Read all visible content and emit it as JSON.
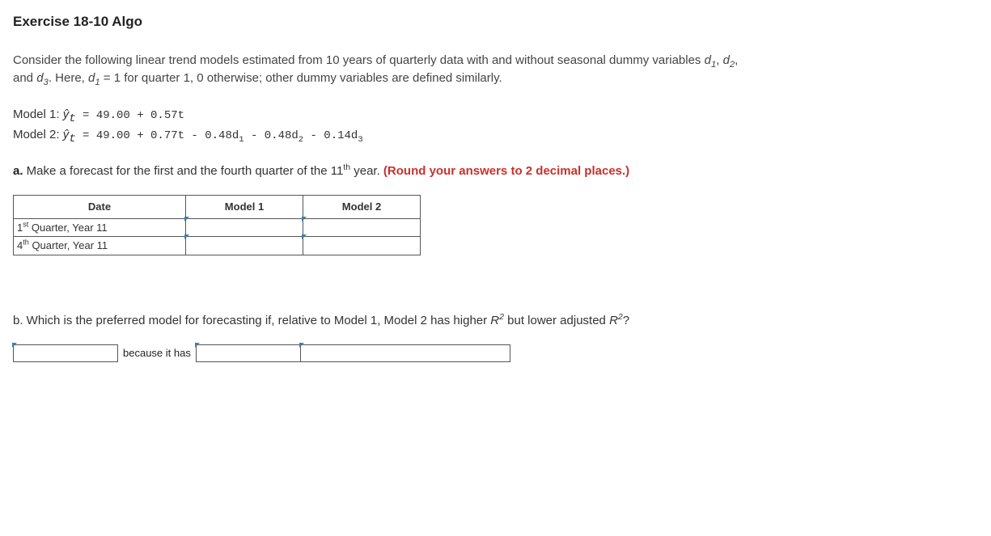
{
  "title": "Exercise 18-10 Algo",
  "intro": {
    "part1": "Consider the following linear trend models estimated from 10 years of quarterly data with and without seasonal dummy variables ",
    "d1": "d",
    "d1_sub": "1",
    "comma1": ", ",
    "d2": "d",
    "d2_sub": "2",
    "comma2": ",",
    "line2a": "and ",
    "d3": "d",
    "d3_sub": "3",
    "line2b": ".  Here, ",
    "d1b": "d",
    "d1b_sub": "1",
    "line2c": " = 1 for quarter 1, 0 otherwise; other dummy variables are defined similarly."
  },
  "models": {
    "m1_label": "Model 1: ",
    "m1_yhat": "ŷ",
    "m1_t": "t",
    "m1_eq": " = 49.00 + 0.57t",
    "m2_label": "Model 2: ",
    "m2_yhat": "ŷ",
    "m2_t": "t",
    "m2_eq_a": " = 49.00 + 0.77t - 0.48d",
    "m2_eq_1": "1",
    "m2_eq_b": " - 0.48d",
    "m2_eq_2": "2",
    "m2_eq_c": " - 0.14d",
    "m2_eq_3": "3"
  },
  "partA": {
    "label": "a.",
    "text1": " Make a forecast for the first and the fourth quarter of the 11",
    "th": "th",
    "text2": " year. ",
    "red": "(Round your answers to 2 decimal places.)"
  },
  "table": {
    "headers": {
      "c0": "Date",
      "c1": "Model 1",
      "c2": "Model 2"
    },
    "rows": [
      {
        "sup": "st",
        "pre": "1",
        "post": " Quarter, Year 11",
        "m1": "",
        "m2": ""
      },
      {
        "sup": "th",
        "pre": "4",
        "post": " Quarter, Year 11",
        "m1": "",
        "m2": ""
      }
    ]
  },
  "partB": {
    "label": "b.",
    "text1": " Which is the preferred model for forecasting if, relative to Model 1, Model 2 has higher ",
    "r2_a": "R",
    "sq": "2",
    "text2": " but lower adjusted ",
    "r2_b": "R",
    "text3": "?"
  },
  "blanks": {
    "b1": "",
    "middle": "because it has",
    "b2": "",
    "b3": ""
  }
}
